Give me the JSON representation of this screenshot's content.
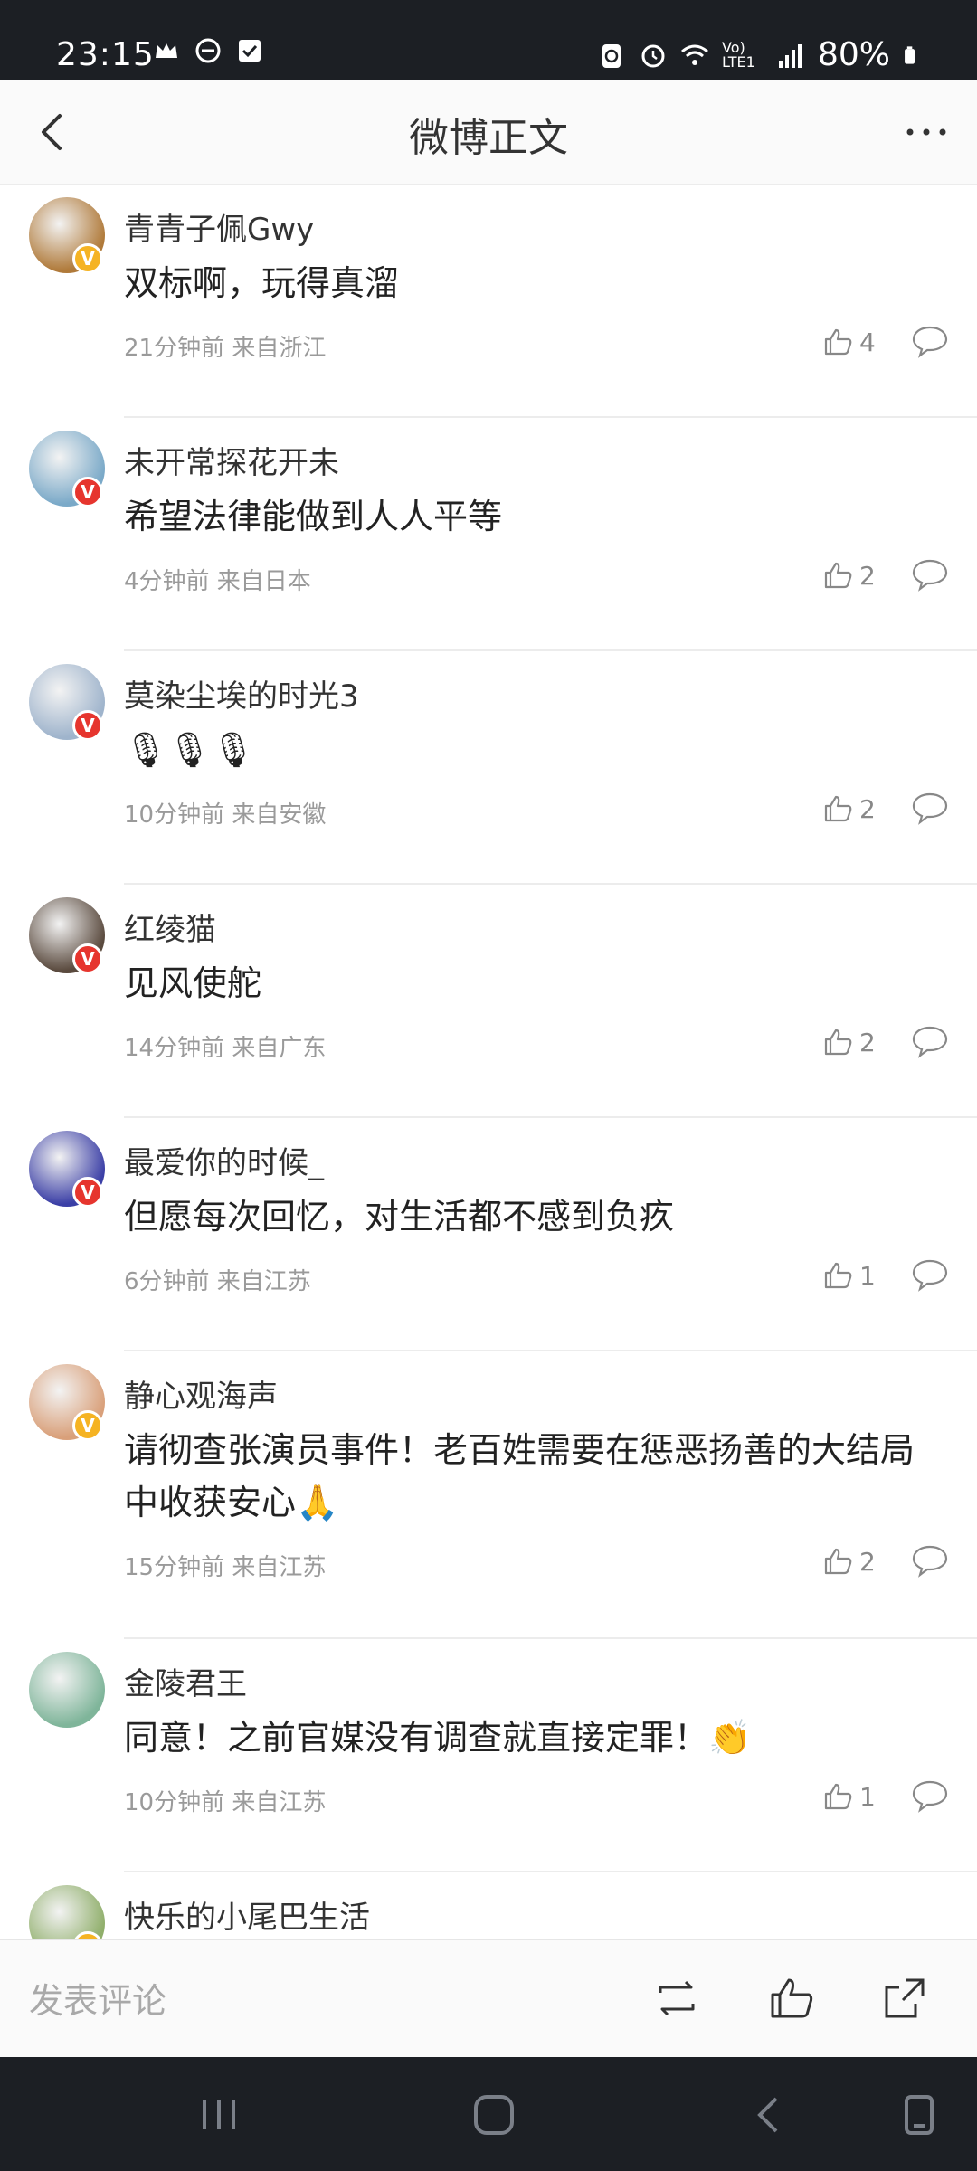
{
  "status": {
    "time": "23:15",
    "battery": "80%",
    "network": "Vo) LTE1"
  },
  "header": {
    "title": "微博正文"
  },
  "comments": [
    {
      "user": "青青子佩Gwy",
      "text": "双标啊，玩得真溜",
      "meta": "21分钟前 来自浙江",
      "likes": "4",
      "badge": "gold",
      "avatar_color": "#b07a3a"
    },
    {
      "user": "未开常探花开未",
      "text": "希望法律能做到人人平等",
      "meta": "4分钟前 来自日本",
      "likes": "2",
      "badge": "red",
      "avatar_color": "#7aa9c8"
    },
    {
      "user": "莫染尘埃的时光3",
      "text": "🎙🎙🎙",
      "meta": "10分钟前 来自安徽",
      "likes": "2",
      "badge": "red",
      "avatar_color": "#9fb4cc"
    },
    {
      "user": "红绫猫",
      "text": "见风使舵",
      "meta": "14分钟前 来自广东",
      "likes": "2",
      "badge": "red",
      "avatar_color": "#5a4a3e"
    },
    {
      "user": "最爱你的时候_",
      "text": "但愿每次回忆，对生活都不感到负疚",
      "meta": "6分钟前 来自江苏",
      "likes": "1",
      "badge": "red",
      "avatar_color": "#3b3fa6"
    },
    {
      "user": "静心观海声",
      "text": "请彻查张演员事件！老百姓需要在惩恶扬善的大结局中收获安心🙏",
      "meta": "15分钟前 来自江苏",
      "likes": "2",
      "badge": "gold",
      "avatar_color": "#d9a07a"
    },
    {
      "user": "金陵君王",
      "text": "同意！之前官媒没有调查就直接定罪！👏",
      "meta": "10分钟前 来自江苏",
      "likes": "1",
      "badge": "none",
      "avatar_color": "#7fb59a"
    },
    {
      "user": "快乐的小尾巴生活",
      "text": "",
      "meta": "",
      "likes": "",
      "badge": "gold",
      "avatar_color": "#8fae6a"
    }
  ],
  "bottom_bar": {
    "comment_placeholder": "发表评论"
  },
  "colors": {
    "statusbar_bg": "#1c1f24",
    "badge_red": "#e6352e",
    "badge_gold": "#f5b323",
    "meta_gray": "#9a9a9a"
  }
}
